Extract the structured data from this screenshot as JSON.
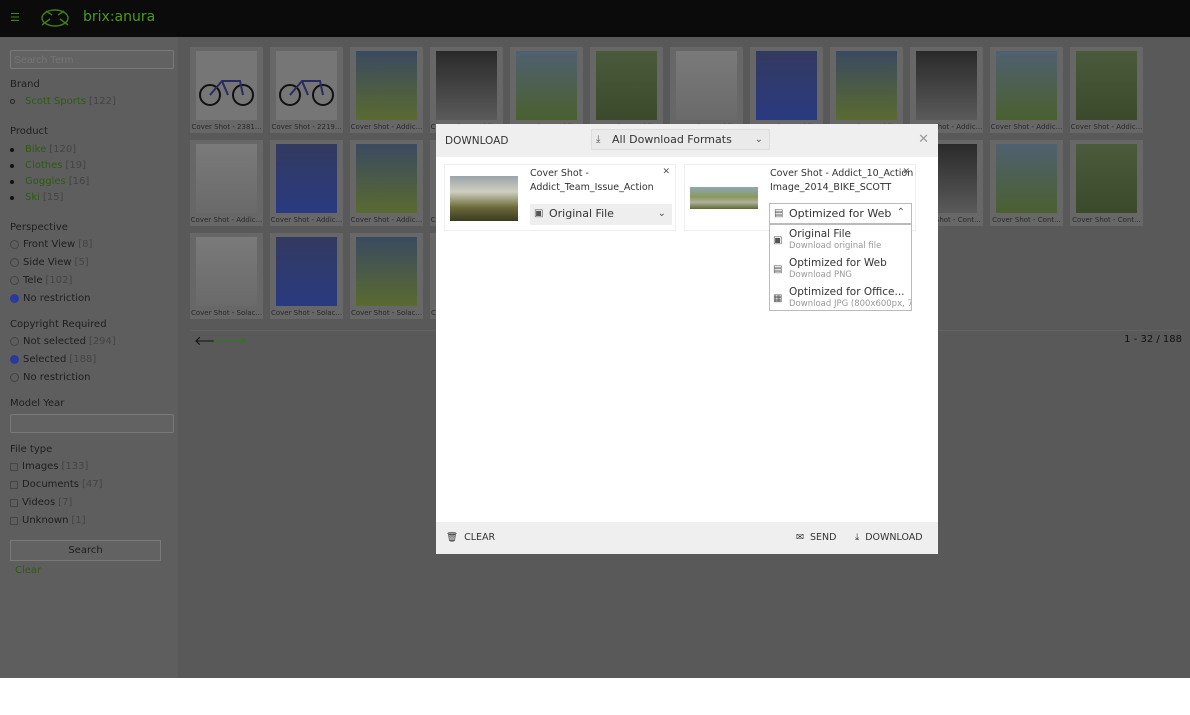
{
  "app": {
    "brand": "brix:anura",
    "accent": "#4a9a1e"
  },
  "sidebar": {
    "search_placeholder": "Search Term",
    "brand": {
      "title": "Brand",
      "items": [
        {
          "label": "Scott Sports",
          "count": "[122]"
        }
      ]
    },
    "product": {
      "title": "Product",
      "items": [
        {
          "label": "Bike",
          "count": "[120]"
        },
        {
          "label": "Clothes",
          "count": "[19]"
        },
        {
          "label": "Goggles",
          "count": "[16]"
        },
        {
          "label": "Ski",
          "count": "[15]"
        }
      ]
    },
    "perspective": {
      "title": "Perspective",
      "items": [
        {
          "label": "Front View",
          "count": "[8]",
          "checked": false
        },
        {
          "label": "Side View",
          "count": "[5]",
          "checked": false
        },
        {
          "label": "Tele",
          "count": "[102]",
          "checked": false
        },
        {
          "label": "No restriction",
          "count": "",
          "checked": true
        }
      ]
    },
    "copyright": {
      "title": "Copyright Required",
      "items": [
        {
          "label": "Not selected",
          "count": "[294]",
          "checked": false
        },
        {
          "label": "Selected",
          "count": "[188]",
          "checked": true
        },
        {
          "label": "No restriction",
          "count": "",
          "checked": false
        }
      ]
    },
    "model_year": {
      "title": "Model Year",
      "value": ""
    },
    "filetype": {
      "title": "File type",
      "items": [
        {
          "label": "Images",
          "count": "[133]"
        },
        {
          "label": "Documents",
          "count": "[47]"
        },
        {
          "label": "Videos",
          "count": "[7]"
        },
        {
          "label": "Unknown",
          "count": "[1]"
        }
      ]
    },
    "search_label": "Search",
    "clear_label": "Clear"
  },
  "grid": {
    "tiles": [
      "Cover Shot - 2381...",
      "Cover Shot - 2219...",
      "Cover Shot - Addic...",
      "Cover Shot - Addic...",
      "Cover Shot - Addic...",
      "Cover Shot - Addic...",
      "Cover Shot - Addic...",
      "Cover Shot - Addic...",
      "Cover Shot - Addic...",
      "Cover Shot - Addic...",
      "Cover Shot - Addic...",
      "Cover Shot - Addic...",
      "Cover Shot - Addic...",
      "Cover Shot - Addic...",
      "Cover Shot - Addic...",
      "Cover Shot - Addic...",
      "Cover Shot - Addic...",
      "Cover Shot - Addic...",
      "Cover Shot - Addic...",
      "Cover Shot - Addic...",
      "Cover Shot - Addic...",
      "Cover Shot - Cont...",
      "Cover Shot - Cont...",
      "Cover Shot - Cont...",
      "Cover Shot - Solac...",
      "Cover Shot - Solac...",
      "Cover Shot - Solac...",
      "Cover Shot - Solac...",
      "Cover Shot - Solac...",
      "Cover Shot - Solac...",
      "Cover Shot - Solac...",
      "Cover Shot - Solac..."
    ],
    "count": "1 - 32 / 188"
  },
  "modal": {
    "title": "DOWNLOAD",
    "format_select": "All Download Formats",
    "items": [
      {
        "name_line1": "Cover Shot -",
        "name_line2": "Addict_Team_Issue_Action",
        "format": "Original File"
      },
      {
        "name_line1": "Cover Shot - Addict_10_Action",
        "name_line2": "Image_2014_BIKE_SCOTT",
        "format": "Optimized for Web"
      }
    ],
    "dropdown": [
      {
        "title": "Original File",
        "sub": "Download original file"
      },
      {
        "title": "Optimized for Web",
        "sub": "Download PNG"
      },
      {
        "title": "Optimized for Office...",
        "sub": "Download JPG (800x600px, 72dpi)"
      }
    ],
    "clear_label": "CLEAR",
    "send_label": "SEND",
    "download_label": "DOWNLOAD"
  }
}
